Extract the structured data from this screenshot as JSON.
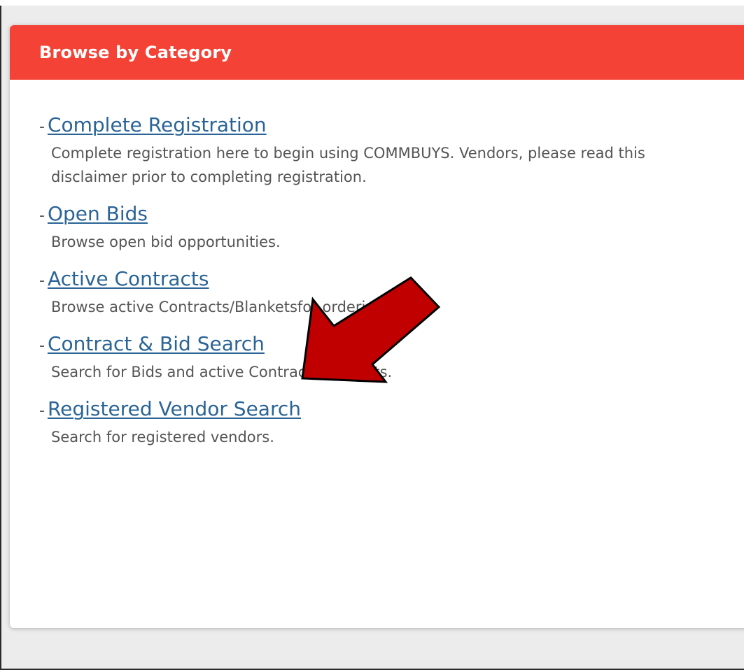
{
  "colors": {
    "header_bg": "#f44336",
    "link": "#2a6496",
    "text": "#555555",
    "arrow_fill": "#c00000"
  },
  "panel": {
    "title": "Browse by Category"
  },
  "categories": [
    {
      "link": "Complete Registration",
      "description": "Complete registration here to begin using COMMBUYS. Vendors, please read this disclaimer prior to completing registration."
    },
    {
      "link": "Open Bids",
      "description": "Browse open bid opportunities."
    },
    {
      "link": "Active Contracts",
      "description": "Browse active Contracts/Blanketsfor ordering."
    },
    {
      "link": "Contract & Bid Search",
      "description": "Search for Bids and active Contracts/Blankets."
    },
    {
      "link": "Registered Vendor Search",
      "description": "Search for registered vendors."
    }
  ],
  "annotation": {
    "icon": "arrow-pointer-icon"
  }
}
